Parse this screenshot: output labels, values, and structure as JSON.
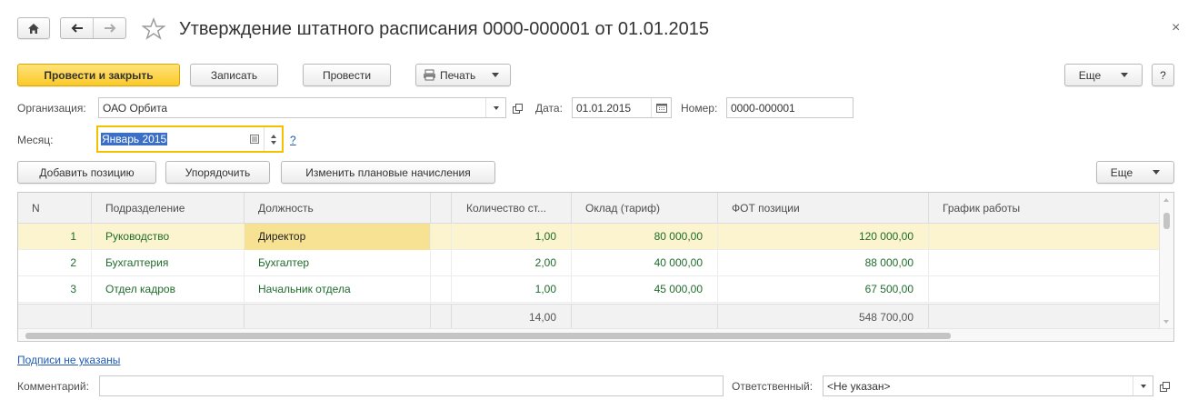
{
  "window": {
    "title": "Утверждение штатного расписания 0000-000001 от 01.01.2015",
    "close_label": "×"
  },
  "toolbar": {
    "post_close": "Провести и закрыть",
    "save": "Записать",
    "post": "Провести",
    "print": "Печать",
    "more": "Еще",
    "help": "?"
  },
  "form": {
    "org_label": "Организация:",
    "org_value": "ОАО Орбита",
    "date_label": "Дата:",
    "date_value": "01.01.2015",
    "number_label": "Номер:",
    "number_value": "0000-000001",
    "month_label": "Месяц:",
    "month_value": "Январь 2015",
    "month_help": "?"
  },
  "table_toolbar": {
    "add": "Добавить позицию",
    "sort": "Упорядочить",
    "change": "Изменить плановые начисления",
    "more": "Еще"
  },
  "table": {
    "columns": [
      "N",
      "Подразделение",
      "Должность",
      "",
      "Количество ст...",
      "Оклад (тариф)",
      "ФОТ  позиции",
      "График работы"
    ],
    "rows": [
      {
        "n": "1",
        "dept": "Руководство",
        "position": "Директор",
        "qty": "1,00",
        "salary": "80 000,00",
        "fot": "120 000,00",
        "schedule": ""
      },
      {
        "n": "2",
        "dept": "Бухгалтерия",
        "position": "Бухгалтер",
        "qty": "2,00",
        "salary": "40 000,00",
        "fot": "88 000,00",
        "schedule": ""
      },
      {
        "n": "3",
        "dept": "Отдел кадров",
        "position": "Начальник отдела",
        "qty": "1,00",
        "salary": "45 000,00",
        "fot": "67 500,00",
        "schedule": ""
      }
    ],
    "totals": {
      "qty": "14,00",
      "fot": "548 700,00"
    }
  },
  "bottom": {
    "signatures_link": "Подписи не указаны",
    "comment_label": "Комментарий:",
    "comment_value": "",
    "responsible_label": "Ответственный:",
    "responsible_value": "<Не указан>"
  },
  "colors": {
    "primary_button": "#fbc928",
    "selected_row": "#fbf4ce",
    "selected_cell": "#f7e293",
    "active_field_border": "#f2c200",
    "data_text": "#206b2c",
    "link": "#1f5ab4"
  }
}
